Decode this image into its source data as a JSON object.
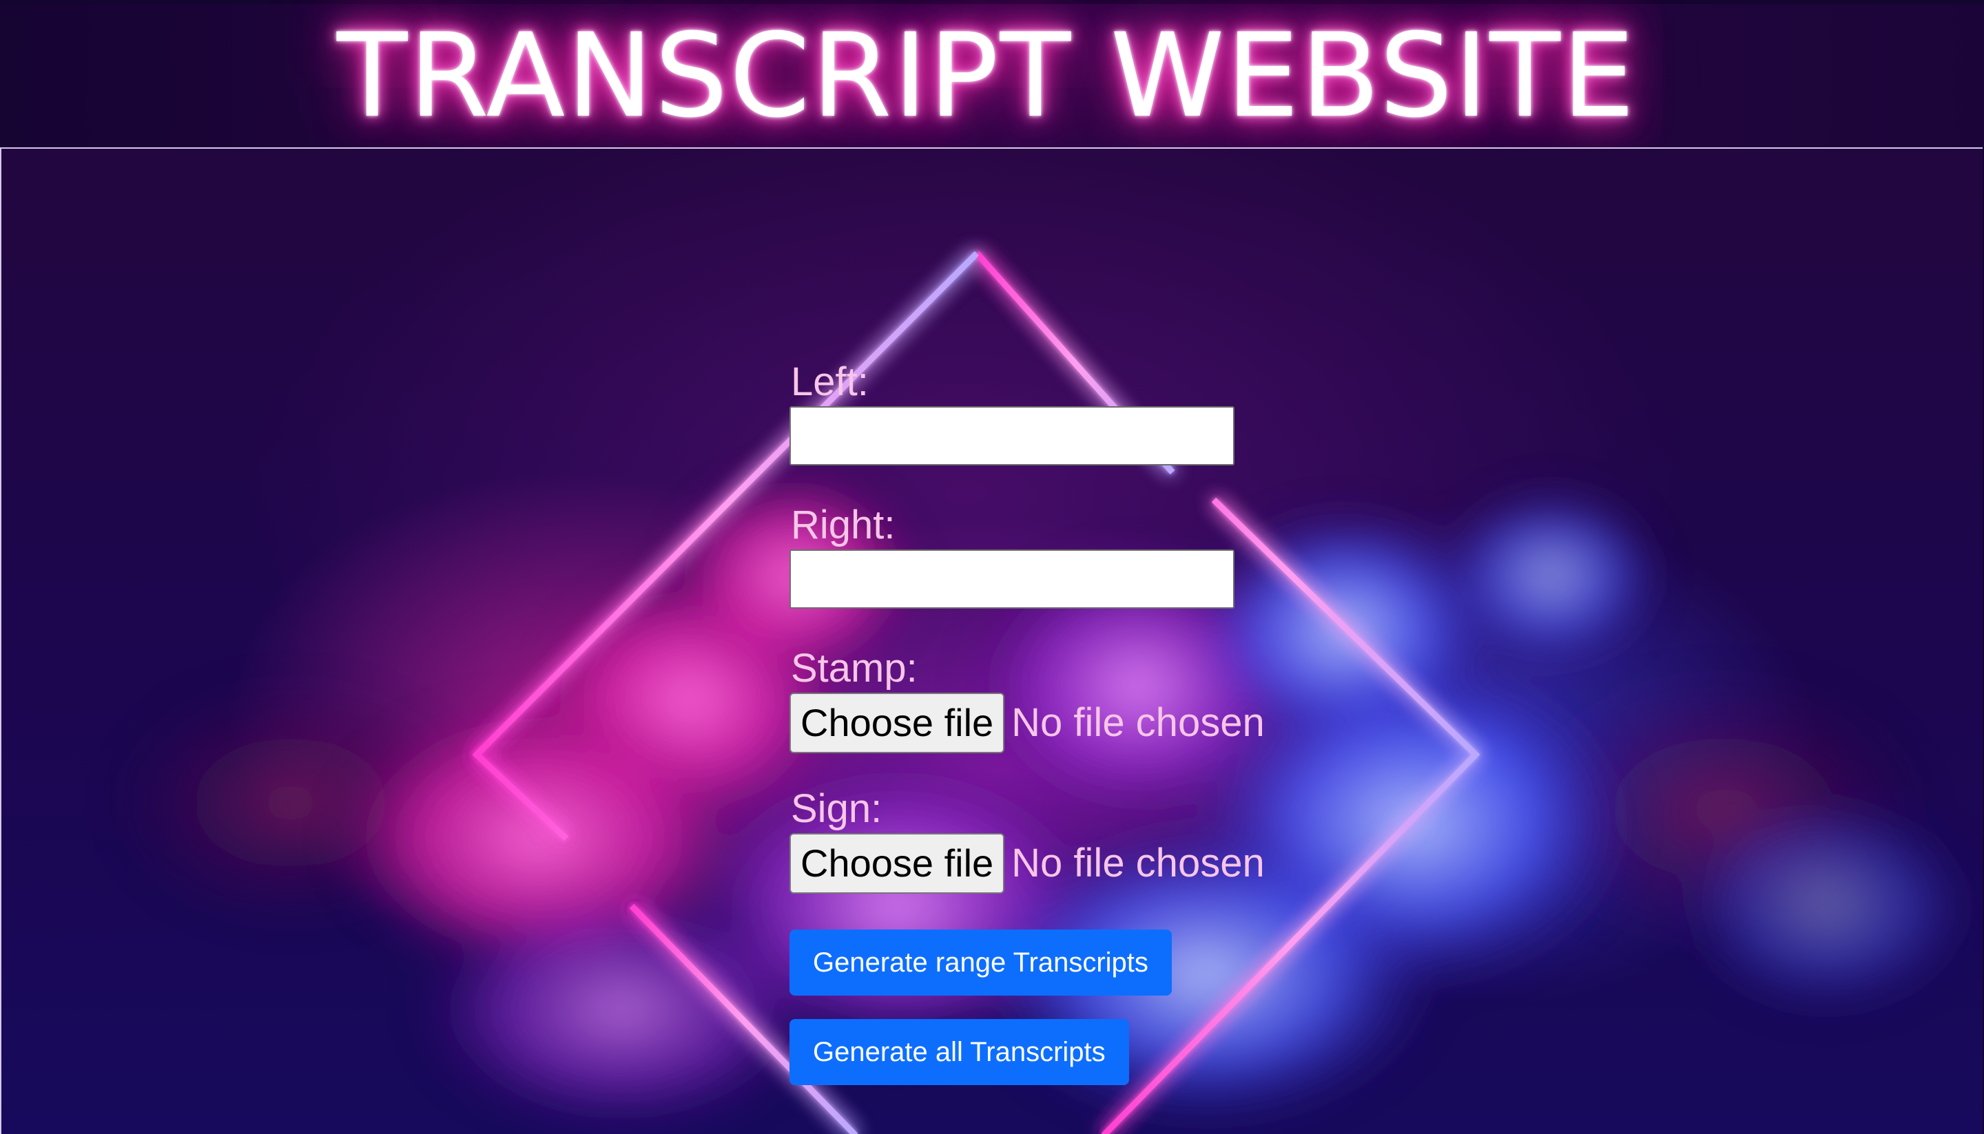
{
  "header": {
    "title": "TRANSCRIPT WEBSITE"
  },
  "form": {
    "left": {
      "label": "Left:",
      "value": "",
      "placeholder": ""
    },
    "right": {
      "label": "Right:",
      "value": "",
      "placeholder": ""
    },
    "stamp": {
      "label": "Stamp:",
      "button_label": "Choose file",
      "status": "No file chosen"
    },
    "sign": {
      "label": "Sign:",
      "button_label": "Choose file",
      "status": "No file chosen"
    },
    "buttons": {
      "generate_range": "Generate range Transcripts",
      "generate_all": "Generate all Transcripts"
    }
  },
  "colors": {
    "primary_button": "#0d6efd",
    "label_text": "#f7c6e8",
    "title_glow": "#ff2fb8",
    "background": "#1c0650"
  },
  "background_image": {
    "icon": "neon-diamond-clouds-image"
  }
}
